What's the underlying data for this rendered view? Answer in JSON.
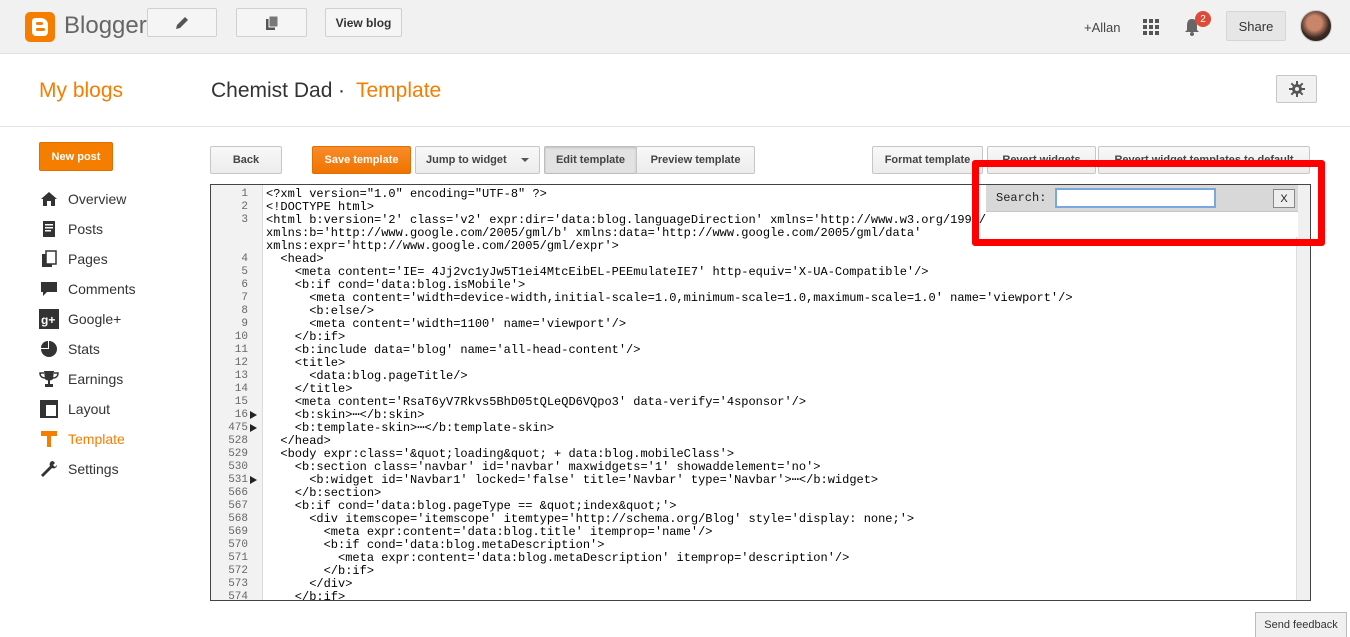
{
  "topbar": {
    "logo_text": "Blogger",
    "view_blog": "View blog",
    "username": "+Allan",
    "notification_count": "2",
    "share": "Share"
  },
  "header": {
    "my_blogs": "My blogs",
    "blog_title": "Chemist Dad",
    "separator": "·",
    "page_name": "Template"
  },
  "sidebar": {
    "new_post": "New post",
    "items": [
      {
        "label": "Overview",
        "icon": "home-icon"
      },
      {
        "label": "Posts",
        "icon": "posts-icon"
      },
      {
        "label": "Pages",
        "icon": "pages-icon"
      },
      {
        "label": "Comments",
        "icon": "comments-icon"
      },
      {
        "label": "Google+",
        "icon": "google-plus-icon"
      },
      {
        "label": "Stats",
        "icon": "stats-icon"
      },
      {
        "label": "Earnings",
        "icon": "trophy-icon"
      },
      {
        "label": "Layout",
        "icon": "layout-icon"
      },
      {
        "label": "Template",
        "icon": "template-icon",
        "active": true
      },
      {
        "label": "Settings",
        "icon": "wrench-icon"
      }
    ]
  },
  "toolbar": {
    "back": "Back",
    "save_template": "Save template",
    "jump_to_widget": "Jump to widget",
    "edit_template": "Edit template",
    "preview_template": "Preview template",
    "format_template": "Format template",
    "revert_widgets": "Revert widgets",
    "revert_widget_templates": "Revert widget templates to default"
  },
  "search": {
    "label": "Search:",
    "value": "",
    "close": "X"
  },
  "editor": {
    "lines": [
      {
        "n": "1",
        "fold": false,
        "code": "<?xml version=\"1.0\" encoding=\"UTF-8\" ?>"
      },
      {
        "n": "2",
        "fold": false,
        "code": "<!DOCTYPE html>"
      },
      {
        "n": "3",
        "fold": false,
        "code": "<html b:version='2' class='v2' expr:dir='data:blog.languageDirection' xmlns='http://www.w3.org/1999/xhtml'"
      },
      {
        "n": "",
        "fold": false,
        "code": "xmlns:b='http://www.google.com/2005/gml/b' xmlns:data='http://www.google.com/2005/gml/data'"
      },
      {
        "n": "",
        "fold": false,
        "code": "xmlns:expr='http://www.google.com/2005/gml/expr'>"
      },
      {
        "n": "4",
        "fold": false,
        "code": "  <head>"
      },
      {
        "n": "5",
        "fold": false,
        "code": "    <meta content='IE= 4Jj2vc1yJw5T1ei4MtcEibEL-PEEmulateIE7' http-equiv='X-UA-Compatible'/>"
      },
      {
        "n": "6",
        "fold": false,
        "code": "    <b:if cond='data:blog.isMobile'>"
      },
      {
        "n": "7",
        "fold": false,
        "code": "      <meta content='width=device-width,initial-scale=1.0,minimum-scale=1.0,maximum-scale=1.0' name='viewport'/>"
      },
      {
        "n": "8",
        "fold": false,
        "code": "      <b:else/>"
      },
      {
        "n": "9",
        "fold": false,
        "code": "      <meta content='width=1100' name='viewport'/>"
      },
      {
        "n": "10",
        "fold": false,
        "code": "    </b:if>"
      },
      {
        "n": "11",
        "fold": false,
        "code": "    <b:include data='blog' name='all-head-content'/>"
      },
      {
        "n": "12",
        "fold": false,
        "code": "    <title>"
      },
      {
        "n": "13",
        "fold": false,
        "code": "      <data:blog.pageTitle/>"
      },
      {
        "n": "14",
        "fold": false,
        "code": "    </title>"
      },
      {
        "n": "15",
        "fold": false,
        "code": "    <meta content='RsaT6yV7Rkvs5BhD05tQLeQD6VQpo3' data-verify='4sponsor'/>"
      },
      {
        "n": "16",
        "fold": true,
        "code": "    <b:skin>⋯</b:skin>"
      },
      {
        "n": "475",
        "fold": true,
        "code": "    <b:template-skin>⋯</b:template-skin>"
      },
      {
        "n": "528",
        "fold": false,
        "code": "  </head>"
      },
      {
        "n": "529",
        "fold": false,
        "code": "  <body expr:class='&quot;loading&quot; + data:blog.mobileClass'>"
      },
      {
        "n": "530",
        "fold": false,
        "code": "    <b:section class='navbar' id='navbar' maxwidgets='1' showaddelement='no'>"
      },
      {
        "n": "531",
        "fold": true,
        "code": "      <b:widget id='Navbar1' locked='false' title='Navbar' type='Navbar'>⋯</b:widget>"
      },
      {
        "n": "566",
        "fold": false,
        "code": "    </b:section>"
      },
      {
        "n": "567",
        "fold": false,
        "code": "    <b:if cond='data:blog.pageType == &quot;index&quot;'>"
      },
      {
        "n": "568",
        "fold": false,
        "code": "      <div itemscope='itemscope' itemtype='http://schema.org/Blog' style='display: none;'>"
      },
      {
        "n": "569",
        "fold": false,
        "code": "        <meta expr:content='data:blog.title' itemprop='name'/>"
      },
      {
        "n": "570",
        "fold": false,
        "code": "        <b:if cond='data:blog.metaDescription'>"
      },
      {
        "n": "571",
        "fold": false,
        "code": "          <meta expr:content='data:blog.metaDescription' itemprop='description'/>"
      },
      {
        "n": "572",
        "fold": false,
        "code": "        </b:if>"
      },
      {
        "n": "573",
        "fold": false,
        "code": "      </div>"
      },
      {
        "n": "574",
        "fold": false,
        "code": "    </b:if>"
      }
    ]
  },
  "footer": {
    "send_feedback": "Send feedback"
  }
}
